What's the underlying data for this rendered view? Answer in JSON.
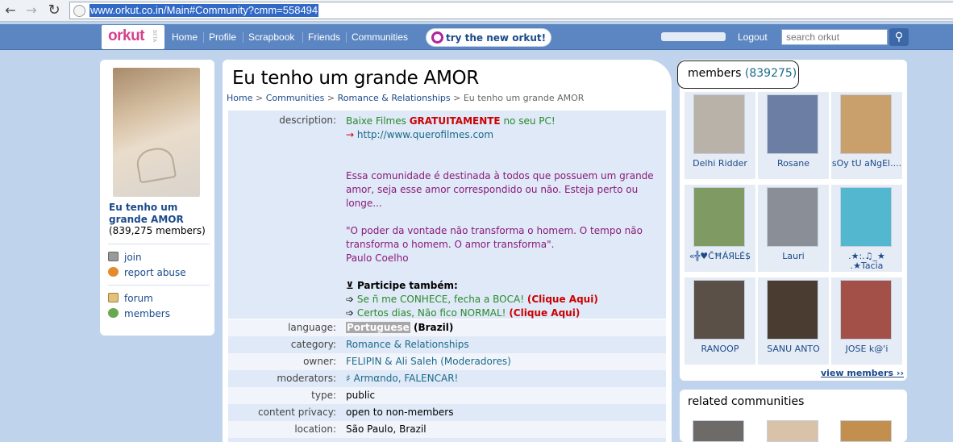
{
  "browser": {
    "back_icon": "back-arrow-icon",
    "forward_icon": "forward-arrow-icon",
    "reload_icon": "reload-icon",
    "url": "www.orkut.co.in/Main#Community?cmm=558494"
  },
  "header": {
    "logo": "orkut",
    "beta": "BETA",
    "nav": [
      "Home",
      "Profile",
      "Scrapbook",
      "Friends",
      "Communities"
    ],
    "try_new": "try the new orkut!",
    "logout": "Logout",
    "search_placeholder": "search orkut"
  },
  "community": {
    "name": "Eu tenho um grande AMOR",
    "member_count_text": "(839,275 members)",
    "actions": [
      {
        "label": "join",
        "icon": "join-icon"
      },
      {
        "label": "report abuse",
        "icon": "report-abuse-icon"
      }
    ],
    "links": [
      {
        "label": "forum",
        "icon": "forum-icon"
      },
      {
        "label": "members",
        "icon": "members-icon"
      }
    ]
  },
  "main": {
    "title": "Eu tenho um grande AMOR",
    "breadcrumb": {
      "home": "Home",
      "sep": ">",
      "communities": "Communities",
      "category": "Romance & Relationships",
      "current": "Eu tenho um grande AMOR"
    },
    "description": {
      "label": "description:",
      "line1_a": "Baixe Filmes ",
      "line1_b": "GRATUITAMENTE",
      "line1_c": " no seu PC!",
      "line2_arrow": "→",
      "line2_link": " http://www.querofilmes.com",
      "para1": "Essa comunidade é destinada à todos que possuem um grande amor, seja esse amor correspondido ou não. Esteja perto ou longe...",
      "quote": "\"O poder da vontade não transforma o homem. O tempo não transforma o homem. O amor transforma\".",
      "author": "Paulo Coelho",
      "participe": "Participe também:",
      "participe_icon": "⊻",
      "links": [
        {
          "arrow": "➩",
          "text": " Se ñ me CONHECE, fecha a BOCA! ",
          "cta": "(Clique Aqui)"
        },
        {
          "arrow": "➩",
          "text": " Certos dias, Não fico NORMAL! ",
          "cta": "(Clique Aqui)"
        }
      ]
    },
    "fields": [
      {
        "label": "language:",
        "value_a": "Portuguese",
        "value_b": " (Brazil)"
      },
      {
        "label": "category:",
        "value": "Romance & Relationships"
      },
      {
        "label": "owner:",
        "value": "FELIPIN & Ali Saleh (Moderadores)"
      },
      {
        "label": "moderators:",
        "value": "♯ Armαndo, FALENCAR!"
      },
      {
        "label": "type:",
        "value": "public"
      },
      {
        "label": "content privacy:",
        "value": "open to non-members"
      },
      {
        "label": "location:",
        "value": "São Paulo, Brazil"
      }
    ]
  },
  "members": {
    "title": "members",
    "count": "(839275)",
    "list": [
      {
        "name": "Delhi Ridder",
        "color": "#b9b2a8"
      },
      {
        "name": "Rosane",
        "color": "#6c7ea3"
      },
      {
        "name": "sOy tU aNgEl....",
        "color": "#c9a06b"
      },
      {
        "name": "«╬♥ČĦÁЯĿÉ$",
        "color": "#7f9a63"
      },
      {
        "name": "Lauri",
        "color": "#8a8f97"
      },
      {
        "name": ".★:.♫_★ .★Tacia",
        "color": "#52b7cf"
      },
      {
        "name": "RANOOP",
        "color": "#5a5048"
      },
      {
        "name": "SANU ANTO",
        "color": "#4b3c31"
      },
      {
        "name": "JOSE k@'i",
        "color": "#a35148"
      }
    ],
    "view_all": "view members ››"
  },
  "related": {
    "title": "related communities",
    "items": [
      {
        "color": "#6d6a68"
      },
      {
        "color": "#d9c2a7"
      },
      {
        "color": "#c38f4e"
      }
    ]
  }
}
